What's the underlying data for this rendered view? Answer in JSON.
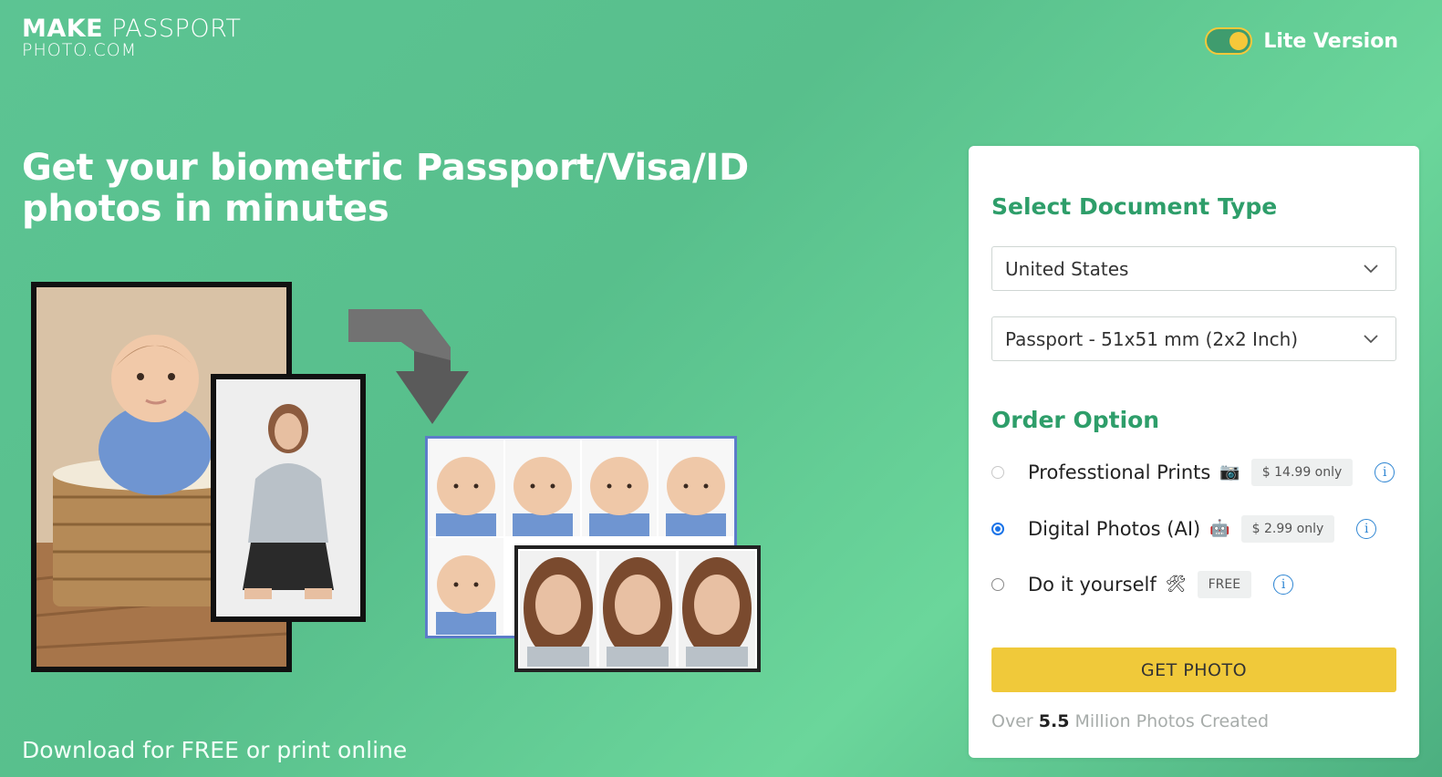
{
  "brand": {
    "logo_bold": "MAKE",
    "logo_light": "PASSPORT",
    "logo_line2": "PHOTO.COM"
  },
  "header": {
    "lite_label": "Lite Version",
    "lite_enabled": true
  },
  "hero": {
    "title": "Get your biometric Passport/Visa/ID photos in minutes",
    "subline": "Download for FREE or print online"
  },
  "form": {
    "section_title": "Select Document Type",
    "country": "United States",
    "document": "Passport - 51x51 mm (2x2 Inch)",
    "order_title": "Order Option",
    "options": [
      {
        "label": "Professtional Prints",
        "icon": "camera-icon",
        "icon_glyph": "📷",
        "price": "$ 14.99 only",
        "selected": false
      },
      {
        "label": "Digital Photos (AI)",
        "icon": "robot-icon",
        "icon_glyph": "🤖",
        "price": "$ 2.99 only",
        "selected": true
      },
      {
        "label": "Do it yourself",
        "icon": "tools-icon",
        "icon_glyph": "🛠",
        "price": "FREE",
        "selected": false
      }
    ],
    "info_glyph": "i",
    "submit_label": "GET PHOTO",
    "stats_prefix": "Over",
    "stats_value": "5.5",
    "stats_suffix": "Million Photos Created"
  },
  "colors": {
    "accent_green": "#2e9e6a",
    "button_yellow": "#f0c93a",
    "radio_blue": "#1a73e8"
  }
}
